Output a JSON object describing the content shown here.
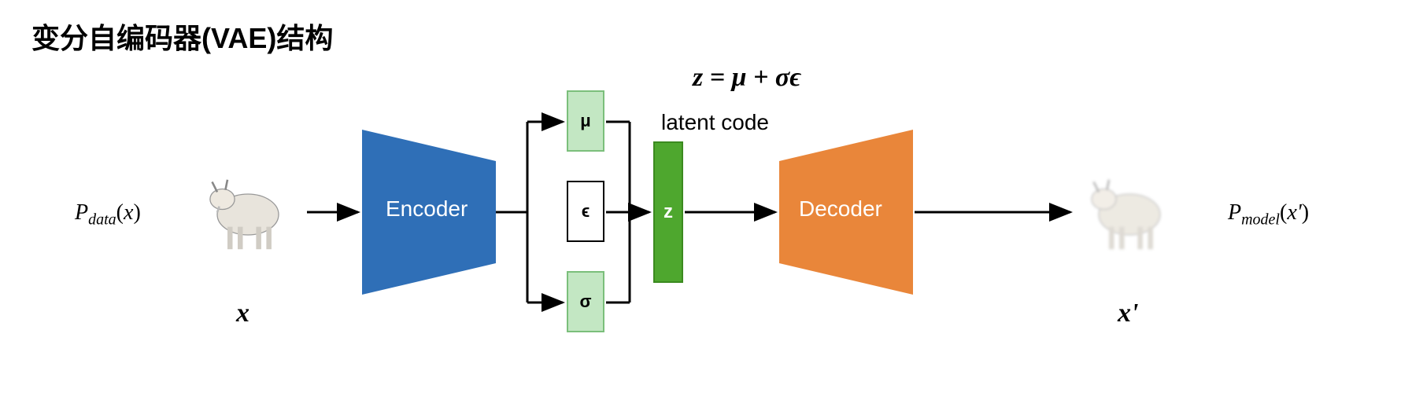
{
  "title": "变分自编码器(VAE)结构",
  "formula": "z = μ + σϵ",
  "latent_label": "latent code",
  "input": {
    "prob_label_html": "P<sub class='sub'>data</sub>(x)",
    "prob_label": "P_data(x)",
    "symbol": "x"
  },
  "encoder": {
    "label": "Encoder"
  },
  "params": {
    "mu": "μ",
    "epsilon": "ϵ",
    "sigma": "σ"
  },
  "latent": {
    "symbol": "z"
  },
  "decoder": {
    "label": "Decoder"
  },
  "output": {
    "prob_label_html": "P<sub class='sub'>model</sub>(x')",
    "prob_label": "P_model(x')",
    "symbol": "x'"
  },
  "colors": {
    "encoder": "#2f6fb7",
    "decoder": "#e9863a",
    "param_box": "#c3e7c3",
    "latent": "#4ea72e"
  }
}
